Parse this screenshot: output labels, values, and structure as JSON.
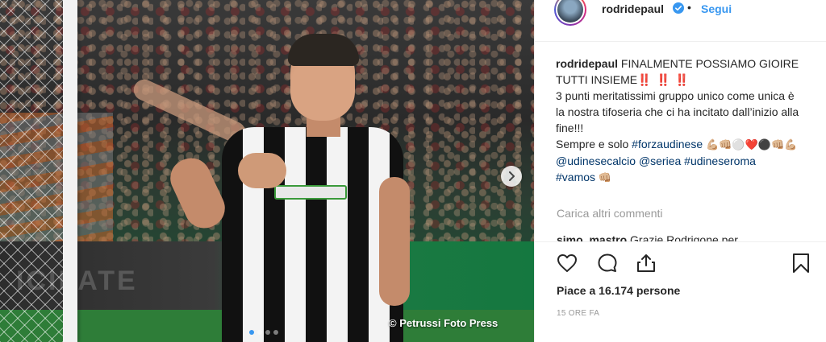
{
  "post": {
    "photo_credit": "© Petrussi Foto Press",
    "ad_text": "ICILATE",
    "carousel": {
      "total": 4,
      "active": 1
    }
  },
  "header": {
    "username": "rodridepaul",
    "bullet": "•",
    "follow_label": "Segui"
  },
  "caption": {
    "username": "rodridepaul",
    "line1": "FINALMENTE POSSIAMO GIOIRE TUTTI INSIEME",
    "bangs": "‼️ ‼️ ‼️",
    "line2": "3 punti meritatissimi gruppo unico come unica è la nostra tifoseria che ci ha incitato dall’inizio alla fine!!!",
    "line3_prefix": "Sempre e solo ",
    "hashtag1": "#forzaudinese",
    "emojis1": "💪🏼👊🏼⚪️❤️⚫️👊🏼💪🏼",
    "mention1": "@udinesecalcio",
    "mention2": "@seriea",
    "hashtag2": "#udineseroma",
    "hashtag3": "#vamos",
    "emoji_end": "👊🏼"
  },
  "comments": {
    "load_more": "Carica altri commenti",
    "peek_user": "simo_mastro",
    "peek_text": "Grazie Rodrigone per"
  },
  "actions": {
    "like_icon": "heart-icon",
    "comment_icon": "comment-icon",
    "share_icon": "share-icon",
    "save_icon": "bookmark-icon"
  },
  "likes_text": "Piace a 16.174 persone",
  "timestamp": "15 ORE FA",
  "colors": {
    "link_blue": "#3897f0",
    "hashtag_blue": "#003569",
    "text": "#262626",
    "muted": "#999999",
    "border": "#efefef",
    "red": "#ed4956"
  }
}
